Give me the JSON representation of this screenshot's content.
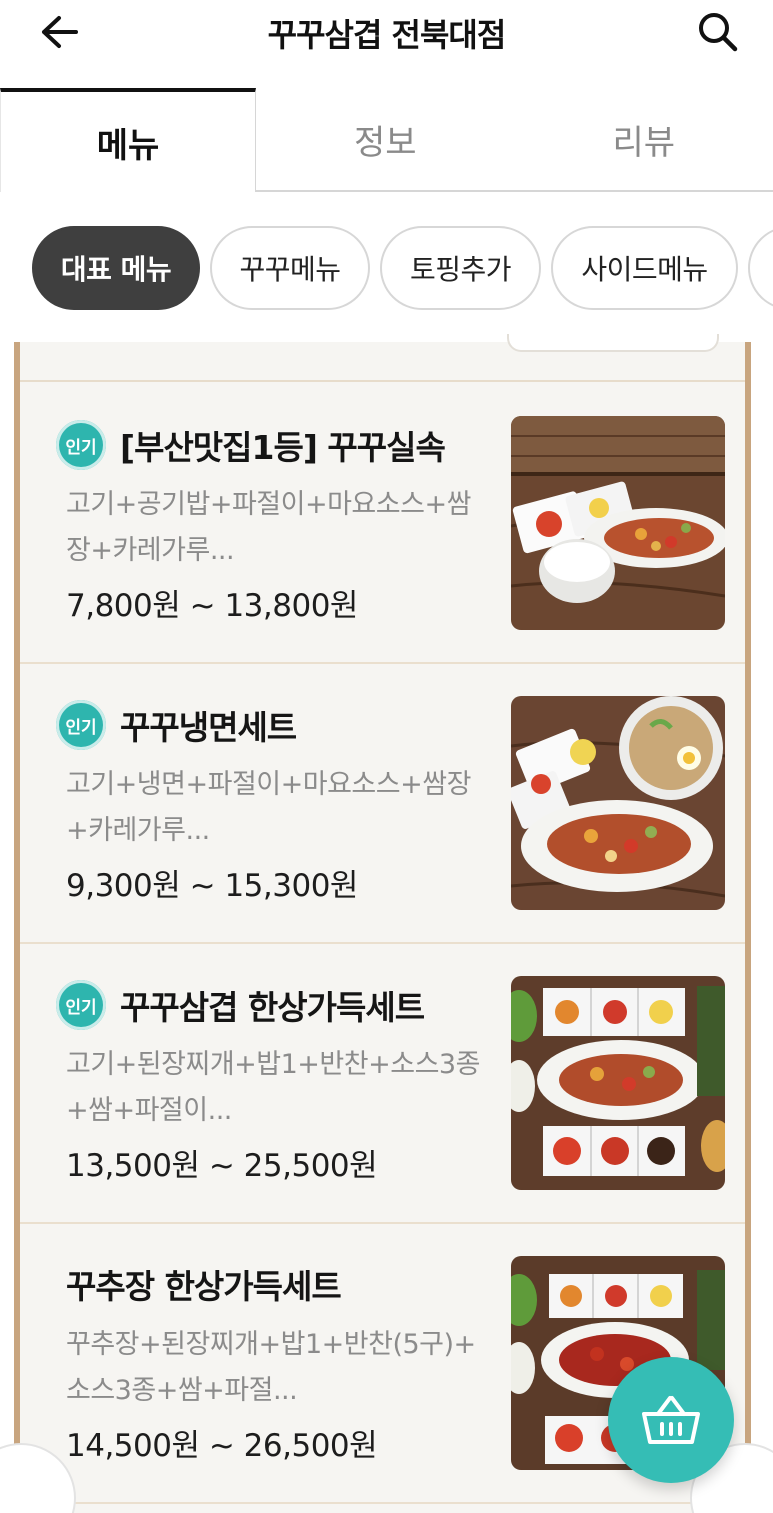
{
  "header": {
    "title": "꾸꾸삼겹 전북대점",
    "back_icon": "arrow-left-icon",
    "search_icon": "search-icon"
  },
  "tabs": [
    {
      "label": "메뉴",
      "active": true
    },
    {
      "label": "정보",
      "active": false
    },
    {
      "label": "리뷰",
      "active": false
    }
  ],
  "categories": [
    {
      "label": "대표 메뉴",
      "active": true
    },
    {
      "label": "꾸꾸메뉴",
      "active": false
    },
    {
      "label": "토핑추가",
      "active": false
    },
    {
      "label": "사이드메뉴",
      "active": false
    }
  ],
  "menu_items": [
    {
      "badge": "인기",
      "name": "[부산맛집1등] 꾸꾸실속",
      "desc_line1": "고기+공기밥+파절이+마요소스+쌈",
      "desc_line2": "장+카레가루...",
      "price": "7,800원 ~ 13,800원"
    },
    {
      "badge": "인기",
      "name": "꾸꾸냉면세트",
      "desc_line1": "고기+냉면+파절이+마요소스+쌈장",
      "desc_line2": "+카레가루...",
      "price": "9,300원 ~ 15,300원"
    },
    {
      "badge": "인기",
      "name": "꾸꾸삼겹 한상가득세트",
      "desc_line1": "고기+된장찌개+밥1+반찬+소스3종",
      "desc_line2": "+쌈+파절이...",
      "price": "13,500원 ~ 25,500원"
    },
    {
      "badge": "",
      "name": "꾸추장 한상가득세트",
      "desc_line1": "꾸추장+된장찌개+밥1+반찬(5구)+",
      "desc_line2": "소스3종+쌈+파절...",
      "price": "14,500원 ~ 26,500원"
    }
  ],
  "cart": {
    "icon": "shopping-basket-icon"
  },
  "colors": {
    "accent": "#35bdb5",
    "badge": "#2eb5ae",
    "chip_active": "#3f3f3f",
    "board_frame": "#c8a57f"
  }
}
